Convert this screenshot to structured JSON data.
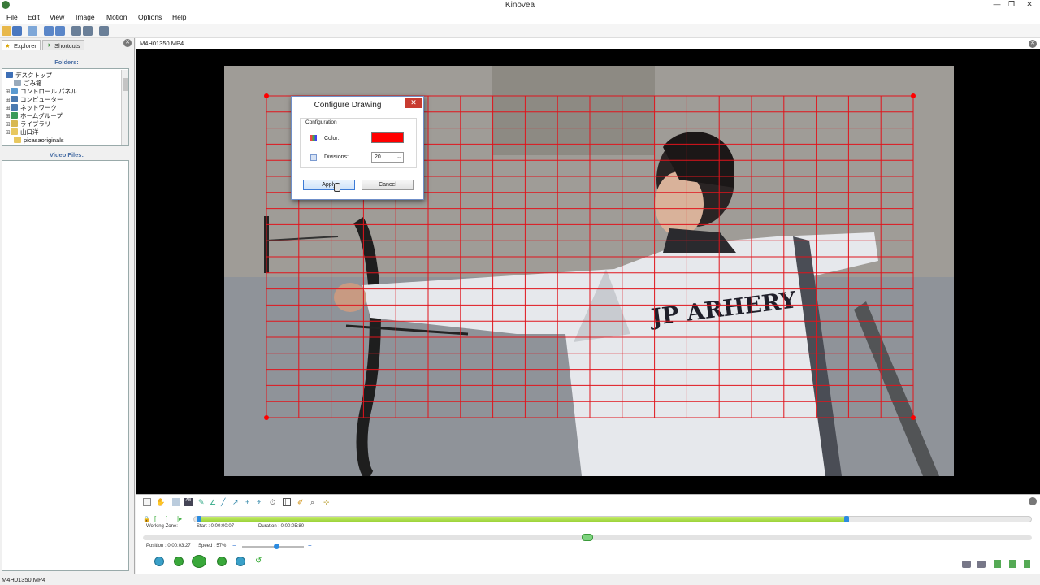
{
  "window": {
    "title": "Kinovea"
  },
  "menu": [
    "File",
    "Edit",
    "View",
    "Image",
    "Motion",
    "Options",
    "Help"
  ],
  "explorer": {
    "tabs": [
      "Explorer",
      "Shortcuts"
    ],
    "folders_heading": "Folders:",
    "folders": [
      "デスクトップ",
      "ごみ箱",
      "コントロール パネル",
      "コンピューター",
      "ネットワーク",
      "ホームグループ",
      "ライブラリ",
      "山口洋",
      "picasaoriginals"
    ],
    "files_heading": "Video Files:"
  },
  "video": {
    "file_tab": "M4H01350.MP4",
    "jersey_text": "JP ARHERY",
    "grid_divisions": 20,
    "grid_color": "#e0141c"
  },
  "dialog": {
    "title": "Configure Drawing",
    "close": "✕",
    "group_label": "Configuration",
    "color_label": "Color:",
    "color_value": "#ff0000",
    "divisions_label": "Divisions:",
    "divisions_value": "20",
    "apply_label": "Apply",
    "cancel_label": "Cancel"
  },
  "playback": {
    "working_zone_label": "Working Zone:",
    "start_text": "Start : 0:00:00:07",
    "duration_text": "Duration : 0:00:05:80",
    "position_text": "Position : 0:00:03:27",
    "speed_text": "Speed : 57%",
    "position_fraction": 0.5,
    "speed_fraction": 0.57
  },
  "status": {
    "text": "M4H01350.MP4"
  }
}
